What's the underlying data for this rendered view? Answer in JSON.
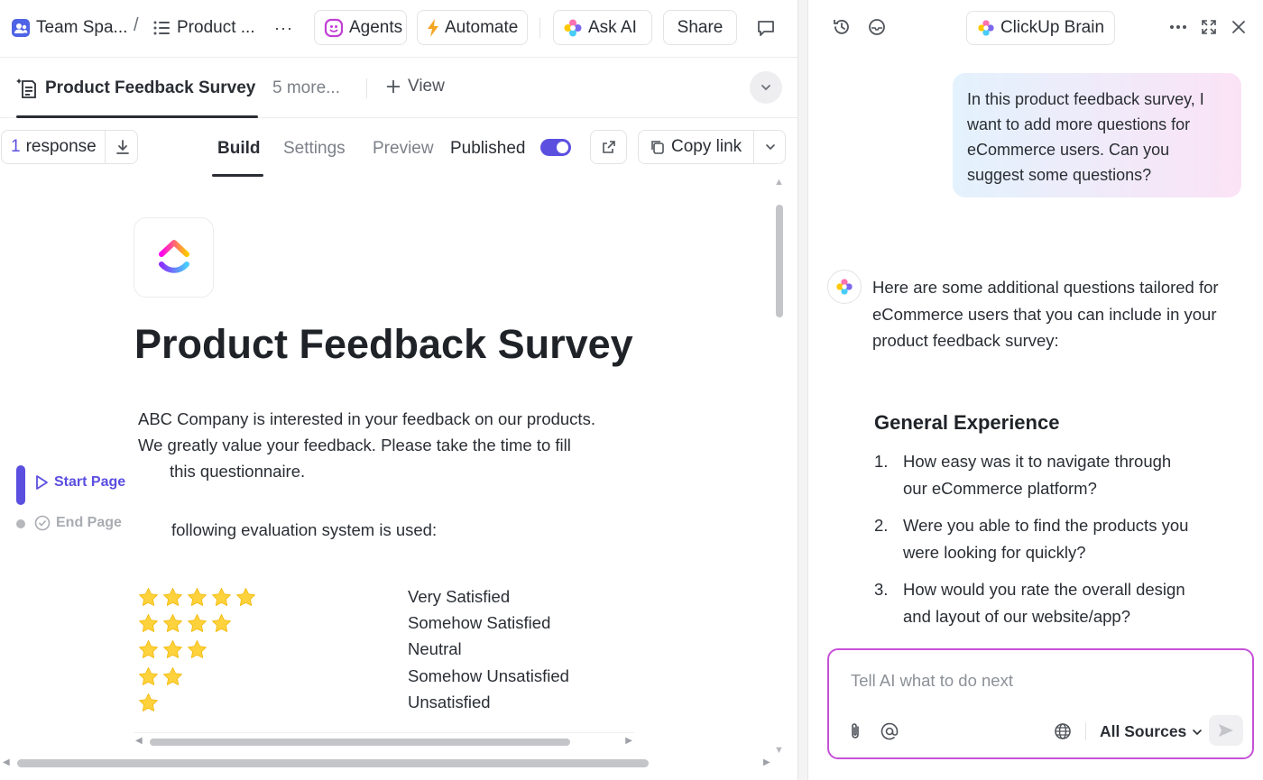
{
  "breadcrumb": {
    "space": "Team Spa...",
    "separator": "/",
    "list": "Product ...",
    "more": "···"
  },
  "toolbar": {
    "agents": "Agents",
    "automate": "Automate",
    "ask_ai": "Ask AI",
    "share": "Share"
  },
  "tabs": {
    "active": "Product Feedback Survey",
    "more": "5 more...",
    "add_view": "View"
  },
  "form_bar": {
    "response_count": "1",
    "response_label": "response",
    "tabs": [
      "Build",
      "Settings",
      "Preview"
    ],
    "published_label": "Published",
    "published": true,
    "copy_link": "Copy link"
  },
  "survey": {
    "title": "Product Feedback Survey",
    "intro_line1": "ABC Company is interested in your feedback on our products.",
    "intro_line2": "We greatly value your feedback. Please take the time to fill",
    "intro_line3": "this questionnaire.",
    "evaluation_intro": "following evaluation system is used:",
    "ratings": [
      {
        "stars": 5,
        "label": "Very Satisfied"
      },
      {
        "stars": 4,
        "label": "Somehow Satisfied"
      },
      {
        "stars": 3,
        "label": "Neutral"
      },
      {
        "stars": 2,
        "label": "Somehow Unsatisfied"
      },
      {
        "stars": 1,
        "label": "Unsatisfied"
      }
    ]
  },
  "page_nav": {
    "start": "Start Page",
    "end": "End Page"
  },
  "assistant": {
    "title": "ClickUp Brain",
    "user_message": "In this product feedback survey, I want to add more questions for eCommerce users. Can you suggest some questions?",
    "ai_intro": "Here are some additional questions tailored for eCommerce users that you can include in your product feedback survey:",
    "section_heading": "General Experience",
    "questions": [
      {
        "num": "1.",
        "line1": "How easy was it to navigate through",
        "line2": "our eCommerce platform?"
      },
      {
        "num": "2.",
        "line1": "Were you able to find the products you",
        "line2": "were looking for quickly?"
      },
      {
        "num": "3.",
        "line1": "How would you rate the overall design",
        "line2": "and layout of our website/app?"
      }
    ],
    "composer_placeholder": "Tell AI what to do next",
    "sources_label": "All Sources"
  },
  "colors": {
    "accent": "#5b4fe0",
    "star": "#fdd23c",
    "composer_border": "#c651d8",
    "bubble_start": "#e3f2fd",
    "bubble_end": "#fbe3f6"
  }
}
